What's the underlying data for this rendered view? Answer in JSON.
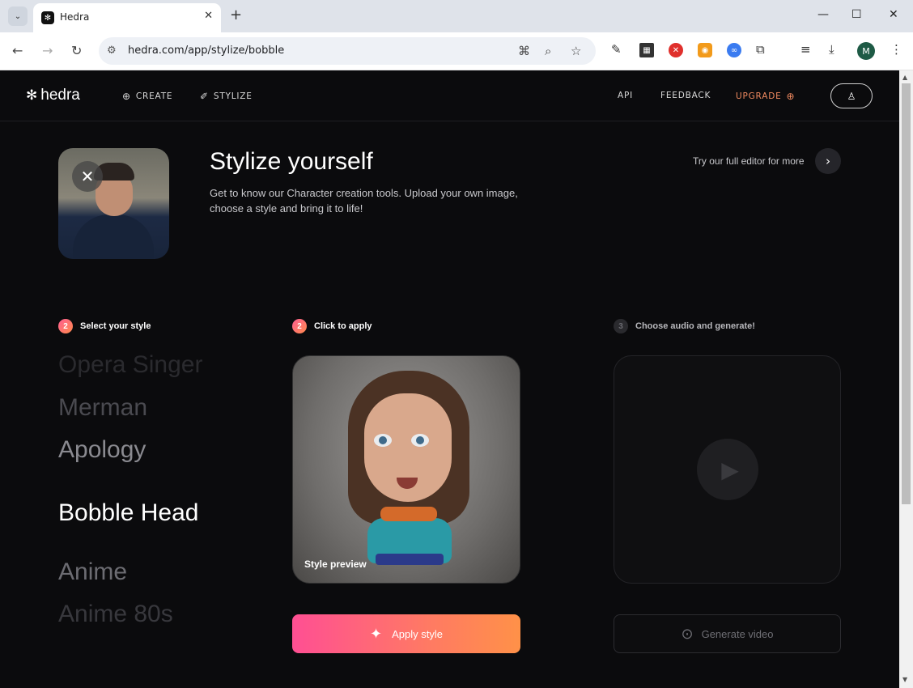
{
  "browser": {
    "tab_title": "Hedra",
    "url": "hedra.com/app/stylize/bobble",
    "profile_initial": "M"
  },
  "nav": {
    "logo": "hedra",
    "create": "CREATE",
    "stylize": "STYLIZE",
    "api": "API",
    "feedback": "FEEDBACK",
    "upgrade": "UPGRADE"
  },
  "hero": {
    "title": "Stylize yourself",
    "description": "Get to know our Character creation tools. Upload your own image, choose a style and bring it to life!",
    "editor_link": "Try our full editor for more"
  },
  "steps": [
    {
      "number": "2",
      "label": "Select your style"
    },
    {
      "number": "2",
      "label": "Click to apply"
    },
    {
      "number": "3",
      "label": "Choose audio and generate!"
    }
  ],
  "styles": [
    "Opera Singer",
    "Merman",
    "Apology",
    "Bobble Head",
    "Anime",
    "Anime 80s"
  ],
  "selected_style": "Bobble Head",
  "preview_label": "Style preview",
  "buttons": {
    "apply": "Apply style",
    "generate": "Generate video"
  },
  "colors": {
    "accent_start": "#ff4f93",
    "accent_end": "#ff9148",
    "upgrade": "#f08a60",
    "background": "#0b0b0d"
  }
}
